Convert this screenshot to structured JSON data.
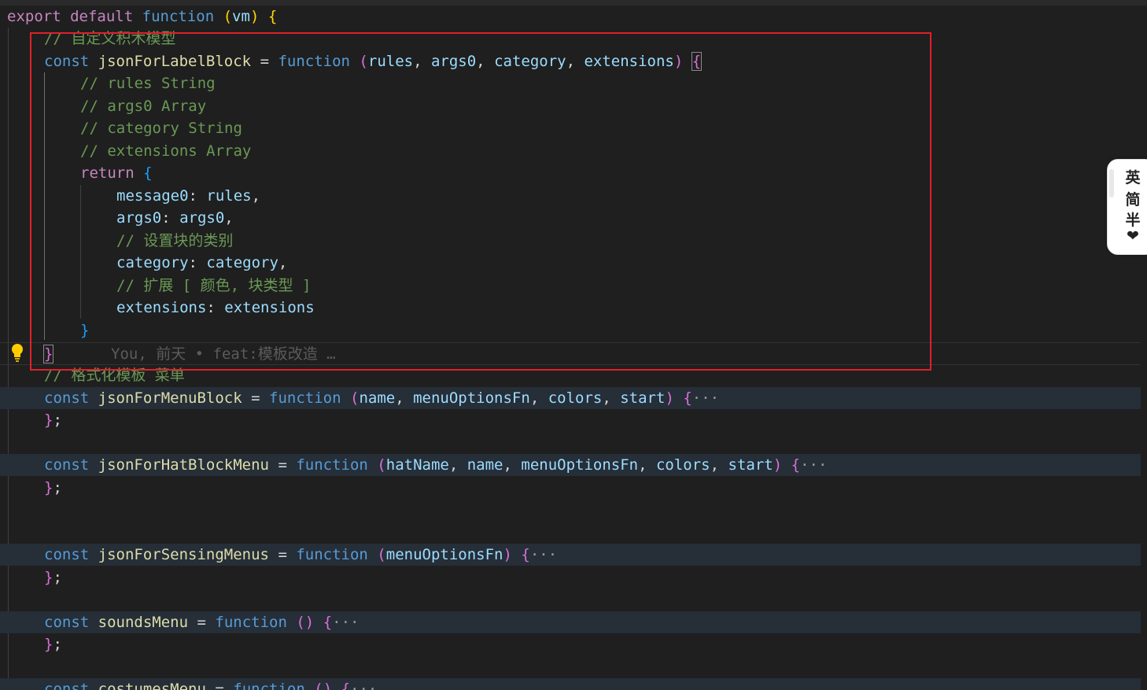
{
  "editor": {
    "lines": [
      {
        "segments": [
          [
            "export",
            "kw-pink"
          ],
          [
            " ",
            ""
          ],
          [
            "default",
            "kw-pink"
          ],
          [
            " ",
            ""
          ],
          [
            "function",
            "kw-blue"
          ],
          [
            " ",
            ""
          ],
          [
            "(",
            "br1"
          ],
          [
            "vm",
            "param"
          ],
          [
            ")",
            "br1"
          ],
          [
            " ",
            ""
          ],
          [
            "{",
            "br1"
          ]
        ]
      },
      {
        "segments": [
          [
            "// 自定义积木模型",
            "comment"
          ]
        ]
      },
      {
        "segments": [
          [
            "const",
            "kw-blue"
          ],
          [
            " ",
            ""
          ],
          [
            "jsonForLabelBlock",
            "fn"
          ],
          [
            " = ",
            "plain"
          ],
          [
            "function",
            "kw-blue"
          ],
          [
            " ",
            ""
          ],
          [
            "(",
            "br2"
          ],
          [
            "rules",
            "param"
          ],
          [
            ", ",
            "plain"
          ],
          [
            "args0",
            "param"
          ],
          [
            ", ",
            "plain"
          ],
          [
            "category",
            "param"
          ],
          [
            ", ",
            "plain"
          ],
          [
            "extensions",
            "param"
          ],
          [
            ")",
            "br2"
          ],
          [
            " ",
            ""
          ],
          [
            "{",
            "br2"
          ]
        ]
      },
      {
        "segments": [
          [
            "// rules String",
            "comment"
          ]
        ]
      },
      {
        "segments": [
          [
            "// args0 Array",
            "comment"
          ]
        ]
      },
      {
        "segments": [
          [
            "// category String",
            "comment"
          ]
        ]
      },
      {
        "segments": [
          [
            "// extensions Array",
            "comment"
          ]
        ]
      },
      {
        "segments": [
          [
            "return",
            "kw-pink"
          ],
          [
            " ",
            ""
          ],
          [
            "{",
            "br3"
          ]
        ]
      },
      {
        "segments": [
          [
            "message0",
            "prop"
          ],
          [
            ": ",
            "plain"
          ],
          [
            "rules",
            "param"
          ],
          [
            ",",
            "plain"
          ]
        ]
      },
      {
        "segments": [
          [
            "args0",
            "prop"
          ],
          [
            ": ",
            "plain"
          ],
          [
            "args0",
            "param"
          ],
          [
            ",",
            "plain"
          ]
        ]
      },
      {
        "segments": [
          [
            "// 设置块的类别",
            "comment"
          ]
        ]
      },
      {
        "segments": [
          [
            "category",
            "prop"
          ],
          [
            ": ",
            "plain"
          ],
          [
            "category",
            "param"
          ],
          [
            ",",
            "plain"
          ]
        ]
      },
      {
        "segments": [
          [
            "// 扩展 [ 颜色, 块类型 ]",
            "comment"
          ]
        ]
      },
      {
        "segments": [
          [
            "extensions",
            "prop"
          ],
          [
            ": ",
            "plain"
          ],
          [
            "extensions",
            "param"
          ]
        ]
      },
      {
        "segments": [
          [
            "}",
            "br3"
          ]
        ]
      },
      {
        "segments": [
          [
            "}",
            "br2"
          ]
        ],
        "blame": "You, 前天 • feat:模板改造 …"
      },
      {
        "segments": [
          [
            "// 格式化模板 菜单",
            "comment"
          ]
        ]
      },
      {
        "segments": [
          [
            "const",
            "kw-blue"
          ],
          [
            " ",
            ""
          ],
          [
            "jsonForMenuBlock",
            "fn"
          ],
          [
            " = ",
            "plain"
          ],
          [
            "function",
            "kw-blue"
          ],
          [
            " ",
            ""
          ],
          [
            "(",
            "br2"
          ],
          [
            "name",
            "param"
          ],
          [
            ", ",
            "plain"
          ],
          [
            "menuOptionsFn",
            "param"
          ],
          [
            ", ",
            "plain"
          ],
          [
            "colors",
            "param"
          ],
          [
            ", ",
            "plain"
          ],
          [
            "start",
            "param"
          ],
          [
            ")",
            "br2"
          ],
          [
            " ",
            ""
          ],
          [
            "{",
            "br2"
          ],
          [
            "···",
            "fold"
          ]
        ]
      },
      {
        "segments": [
          [
            "}",
            "br2"
          ],
          [
            ";",
            "plain"
          ]
        ]
      },
      {
        "segments": []
      },
      {
        "segments": [
          [
            "const",
            "kw-blue"
          ],
          [
            " ",
            ""
          ],
          [
            "jsonForHatBlockMenu",
            "fn"
          ],
          [
            " = ",
            "plain"
          ],
          [
            "function",
            "kw-blue"
          ],
          [
            " ",
            ""
          ],
          [
            "(",
            "br2"
          ],
          [
            "hatName",
            "param"
          ],
          [
            ", ",
            "plain"
          ],
          [
            "name",
            "param"
          ],
          [
            ", ",
            "plain"
          ],
          [
            "menuOptionsFn",
            "param"
          ],
          [
            ", ",
            "plain"
          ],
          [
            "colors",
            "param"
          ],
          [
            ", ",
            "plain"
          ],
          [
            "start",
            "param"
          ],
          [
            ")",
            "br2"
          ],
          [
            " ",
            ""
          ],
          [
            "{",
            "br2"
          ],
          [
            "···",
            "fold"
          ]
        ]
      },
      {
        "segments": [
          [
            "}",
            "br2"
          ],
          [
            ";",
            "plain"
          ]
        ]
      },
      {
        "segments": []
      },
      {
        "segments": [
          [
            "const",
            "kw-blue"
          ],
          [
            " ",
            ""
          ],
          [
            "jsonForSensingMenus",
            "fn"
          ],
          [
            " = ",
            "plain"
          ],
          [
            "function",
            "kw-blue"
          ],
          [
            " ",
            ""
          ],
          [
            "(",
            "br2"
          ],
          [
            "menuOptionsFn",
            "param"
          ],
          [
            ")",
            "br2"
          ],
          [
            " ",
            ""
          ],
          [
            "{",
            "br2"
          ],
          [
            "···",
            "fold"
          ]
        ]
      },
      {
        "segments": [
          [
            "}",
            "br2"
          ],
          [
            ";",
            "plain"
          ]
        ]
      },
      {
        "segments": []
      },
      {
        "segments": [
          [
            "const",
            "kw-blue"
          ],
          [
            " ",
            ""
          ],
          [
            "soundsMenu",
            "fn"
          ],
          [
            " = ",
            "plain"
          ],
          [
            "function",
            "kw-blue"
          ],
          [
            " ",
            ""
          ],
          [
            "(",
            "br2"
          ],
          [
            ")",
            "br2"
          ],
          [
            " ",
            ""
          ],
          [
            "{",
            "br2"
          ],
          [
            "···",
            "fold"
          ]
        ]
      },
      {
        "segments": [
          [
            "}",
            "br2"
          ],
          [
            ";",
            "plain"
          ]
        ]
      },
      {
        "segments": []
      },
      {
        "segments": [
          [
            "const",
            "kw-blue"
          ],
          [
            " ",
            ""
          ],
          [
            "costumesMenu",
            "fn"
          ],
          [
            " = ",
            "plain"
          ],
          [
            "function",
            "kw-blue"
          ],
          [
            " ",
            ""
          ],
          [
            "(",
            "br2"
          ],
          [
            ")",
            "br2"
          ],
          [
            " ",
            ""
          ],
          [
            "{",
            "br2"
          ],
          [
            "···",
            "fold"
          ]
        ]
      }
    ]
  },
  "ime_toolbar": {
    "items": [
      "英",
      "简",
      "半",
      "❤"
    ]
  },
  "colors": {
    "annotation_border": "#e0202a",
    "background": "#1f1f1f",
    "folded_highlight": "#262e38"
  }
}
